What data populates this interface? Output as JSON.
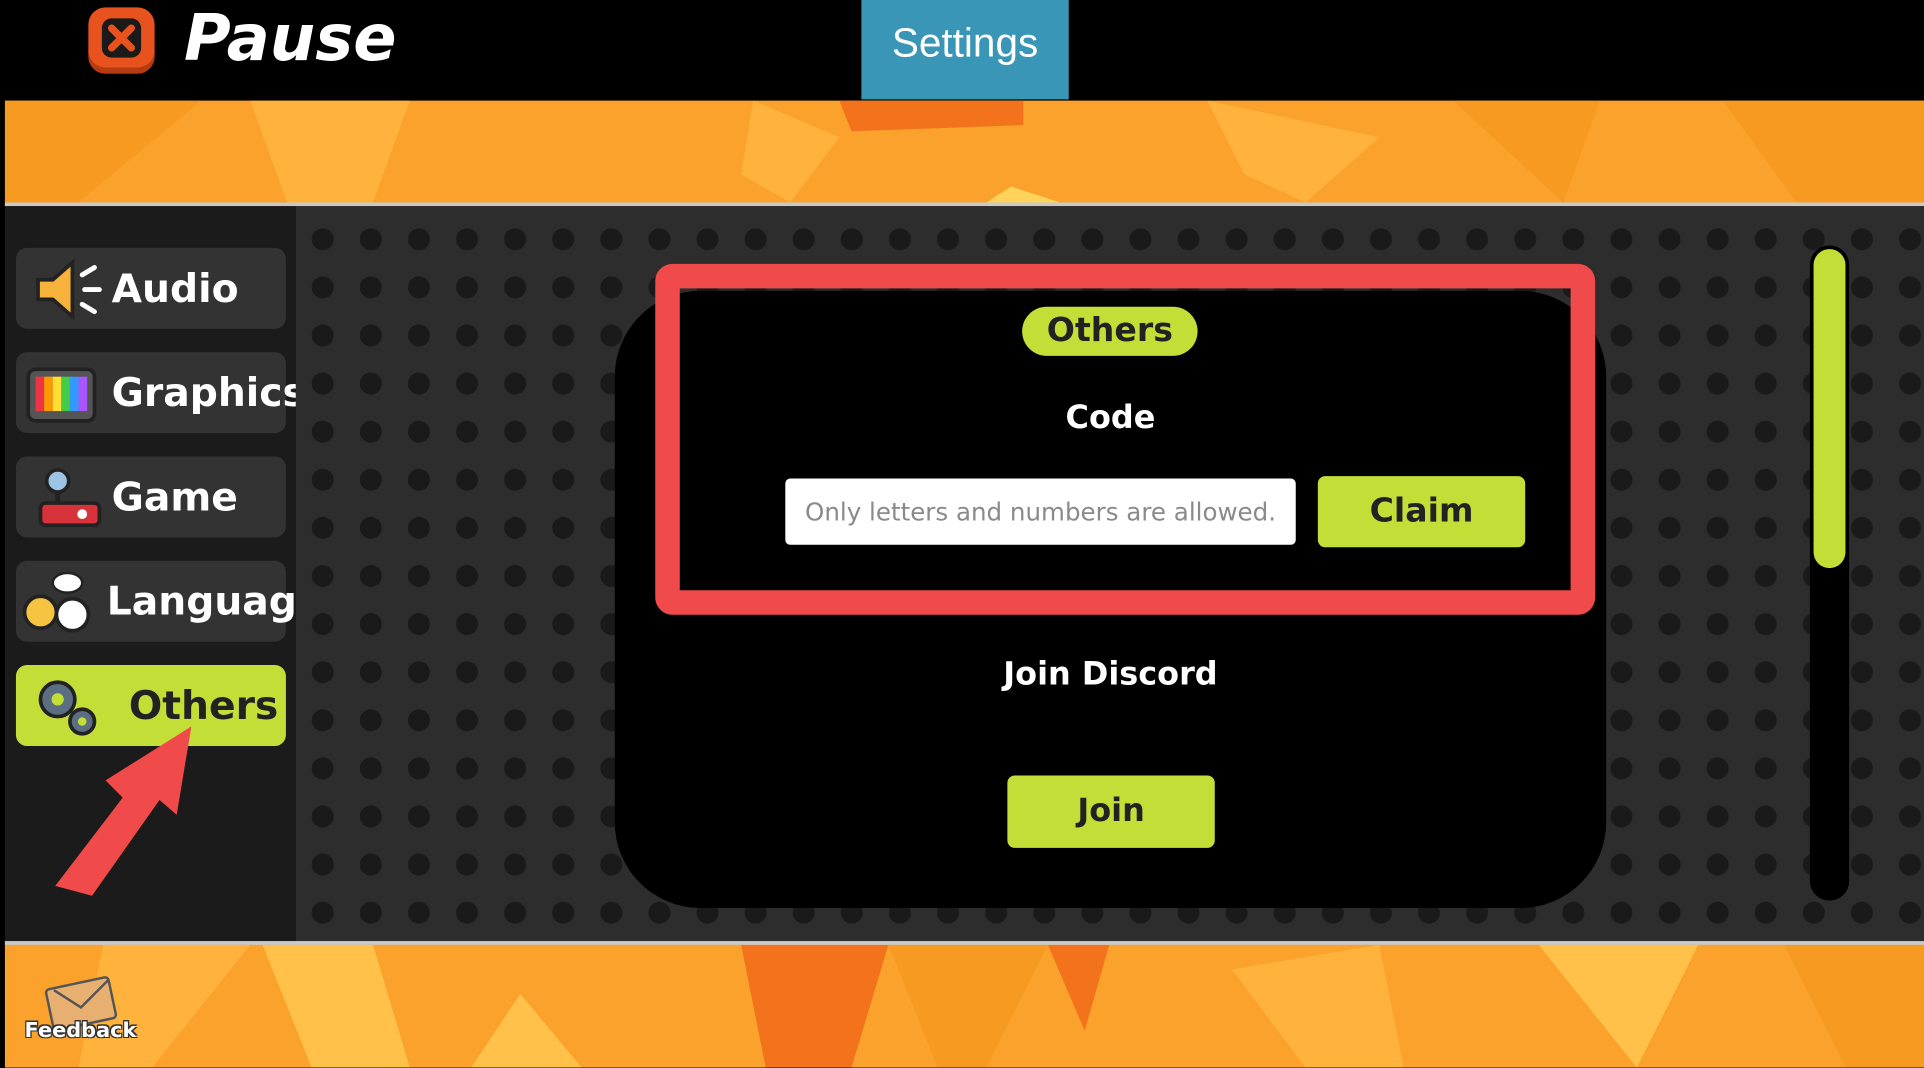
{
  "header": {
    "pause_title": "Pause",
    "settings_tab": "Settings"
  },
  "sidebar": {
    "items": [
      {
        "label": "Audio",
        "icon": "speaker-icon"
      },
      {
        "label": "Graphics",
        "icon": "tv-icon"
      },
      {
        "label": "Game",
        "icon": "joystick-icon"
      },
      {
        "label": "Language",
        "icon": "chat-characters-icon"
      },
      {
        "label": "Others",
        "icon": "gears-icon",
        "active": true
      }
    ]
  },
  "panel": {
    "section_title": "Others",
    "code_label": "Code",
    "code_placeholder": "Only letters and numbers are allowed.",
    "code_value": "",
    "claim_label": "Claim",
    "discord_label": "Join Discord",
    "join_label": "Join"
  },
  "footer": {
    "feedback_label": "Feedback"
  },
  "colors": {
    "accent_green": "#c3df37",
    "orange_band": "#fba22c",
    "settings_tab_blue": "#3a96b6",
    "highlight_red": "#f04a4a",
    "close_orange": "#e8521e"
  }
}
